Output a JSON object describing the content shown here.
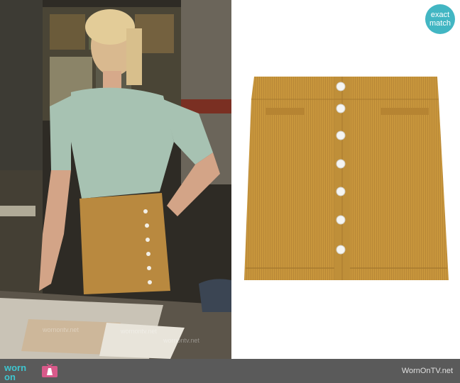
{
  "badge": {
    "line1": "exact",
    "line2": "match"
  },
  "footer": {
    "logo_word1": "worn",
    "logo_word2": "on",
    "logo_tv": "tv",
    "site": "WornOnTV.net"
  },
  "watermark": "wornontv.net",
  "colors": {
    "skirt": "#c8963c",
    "badge": "#42b6c3",
    "footer": "#5a5a5a"
  }
}
